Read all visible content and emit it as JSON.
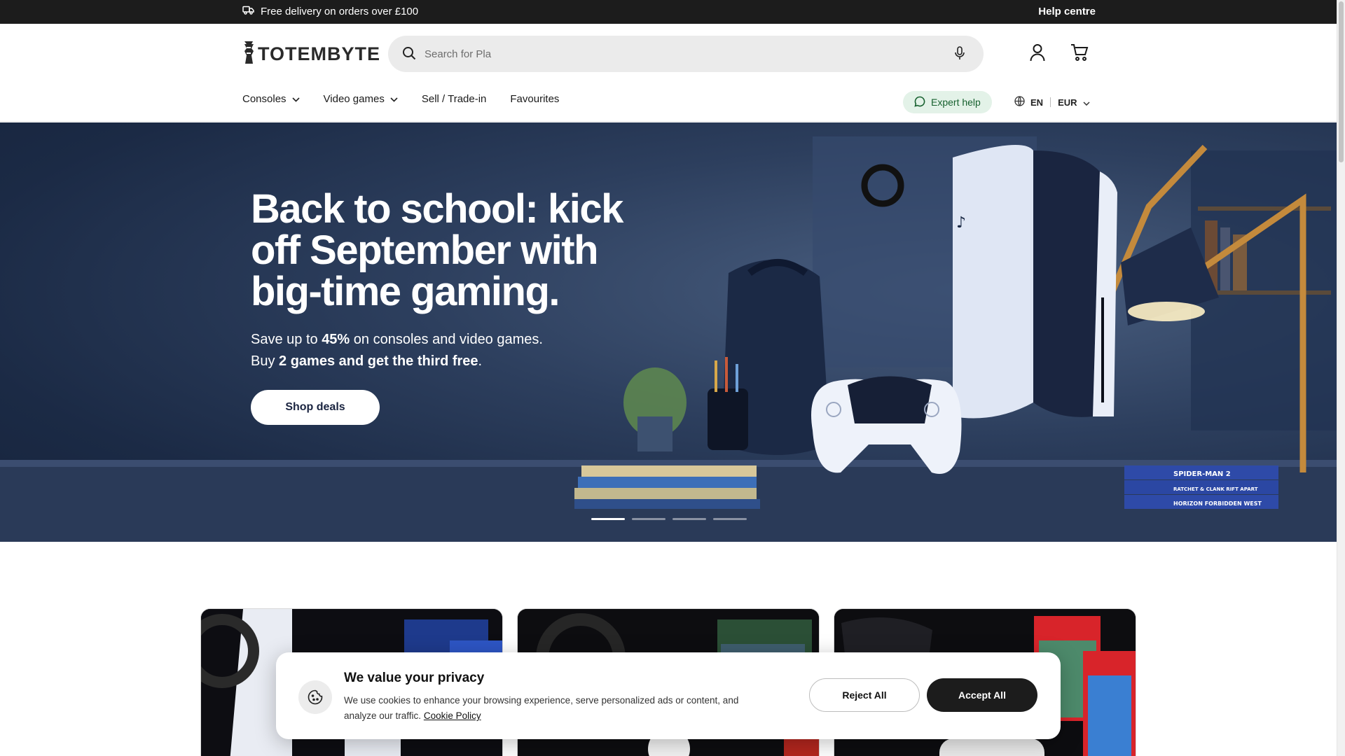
{
  "announcement": {
    "delivery_text": "Free delivery on orders over £100",
    "delivery_icon": "truck-icon",
    "help_label": "Help centre"
  },
  "header": {
    "logo_text": "TOTEMBYTE",
    "search": {
      "value": "",
      "placeholder": "Search for Pla",
      "icon": "search-icon",
      "mic_icon": "microphone-icon"
    },
    "account_icon": "user-icon",
    "cart_icon": "cart-icon"
  },
  "nav": {
    "items": [
      {
        "label": "Consoles",
        "has_dropdown": true
      },
      {
        "label": "Video games",
        "has_dropdown": true
      },
      {
        "label": "Sell / Trade-in",
        "has_dropdown": false
      },
      {
        "label": "Favourites",
        "has_dropdown": false
      }
    ],
    "expert_help_label": "Expert help",
    "language": "EN",
    "currency": "EUR"
  },
  "hero": {
    "title": "Back to school: kick off September with big-time gaming.",
    "sub1_a": "Save up to ",
    "sub1_b": "45%",
    "sub1_c": " on consoles and video games.",
    "sub2_a": "Buy ",
    "sub2_b": "2 games and get the third free",
    "sub2_c": ".",
    "cta": "Shop deals",
    "slides": 4,
    "active_slide": 1,
    "game_spines": [
      "SPIDER-MAN 2",
      "RATCHET & CLANK RIFT APART",
      "HORIZON FORBIDDEN WEST"
    ]
  },
  "cookie": {
    "title": "We value your privacy",
    "body": "We use cookies to enhance your browsing experience, serve personalized ads or content, and analyze our traffic.",
    "policy_link": "Cookie Policy",
    "reject_label": "Reject All",
    "accept_label": "Accept All",
    "icon": "cookie-icon"
  },
  "colors": {
    "topbar": "#1c1c1c",
    "expert_bg": "#e3f2e8",
    "expert_text": "#17612f",
    "hero_bg": "#1b2a45",
    "accept_bg": "#1c1c1c"
  }
}
